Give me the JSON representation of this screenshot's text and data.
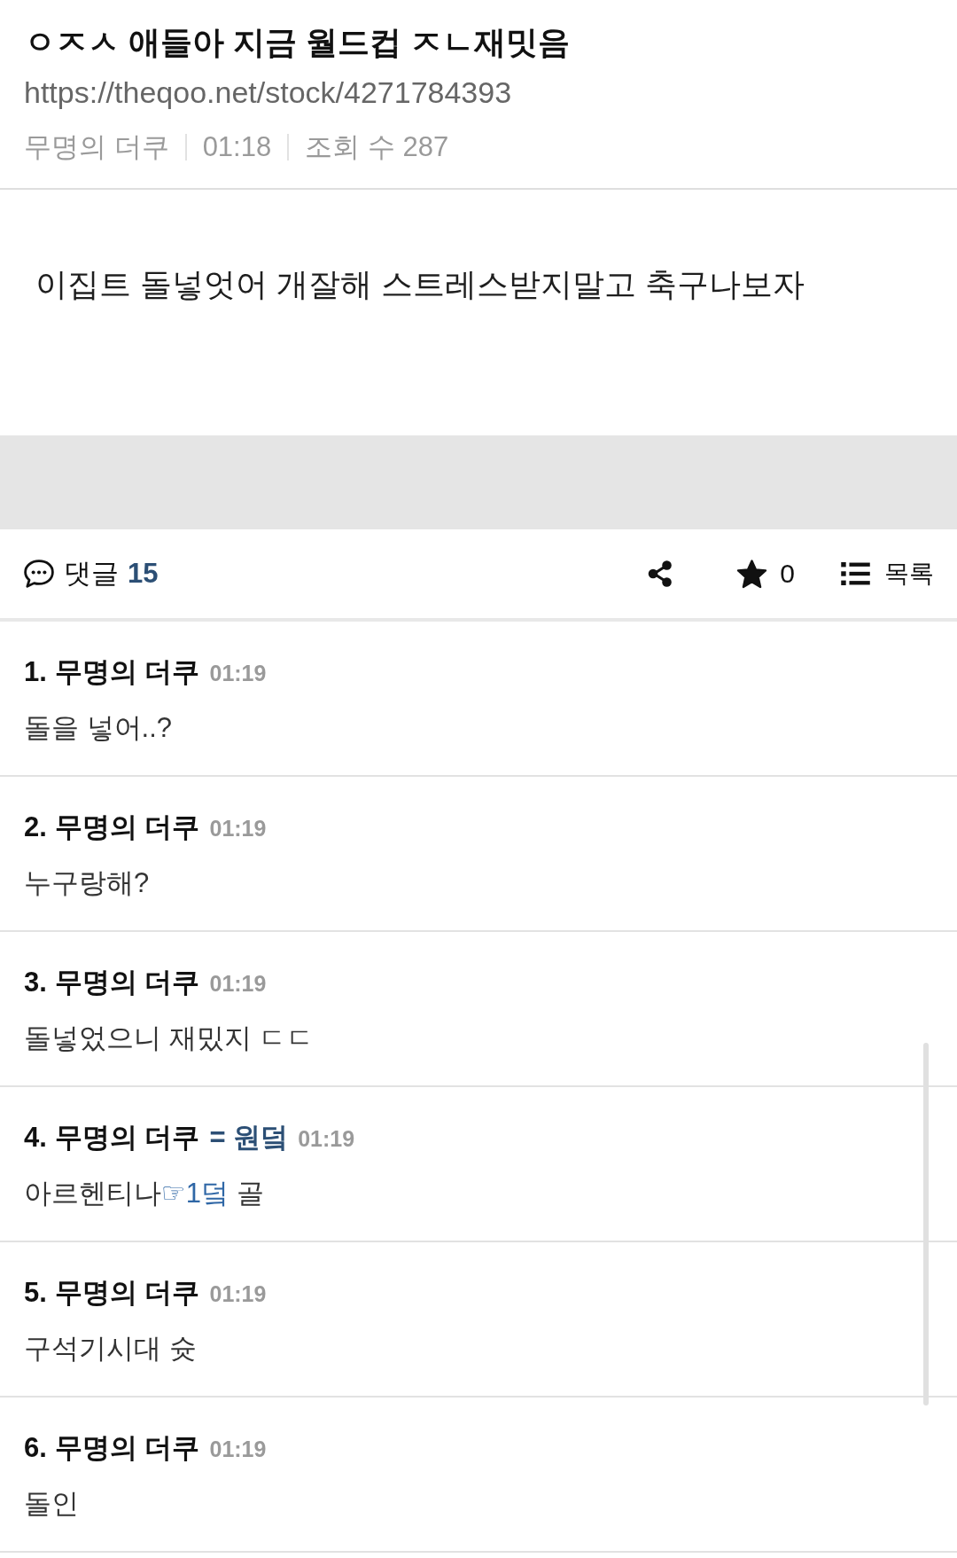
{
  "post": {
    "title": "ㅇㅈㅅ 애들아 지금 월드컵 ㅈㄴ재밋음",
    "url": "https://theqoo.net/stock/4271784393",
    "author": "무명의 더쿠",
    "time": "01:18",
    "views": "조회 수 287",
    "body": "이집트 돌넣엇어 개잘해 스트레스받지말고 축구나보자"
  },
  "action_bar": {
    "comments_label": "댓글",
    "comments_count": "15",
    "star_count": "0",
    "list_label": "목록"
  },
  "comments": [
    {
      "number": "1.",
      "author": "무명의 더쿠",
      "time": "01:19",
      "segments": [
        {
          "kind": "text",
          "text": "돌을 넣어..?"
        }
      ]
    },
    {
      "number": "2.",
      "author": "무명의 더쿠",
      "time": "01:19",
      "segments": [
        {
          "kind": "text",
          "text": "누구랑해?"
        }
      ]
    },
    {
      "number": "3.",
      "author": "무명의 더쿠",
      "time": "01:19",
      "segments": [
        {
          "kind": "text",
          "text": "돌넣었으니 재밌지 ㄷㄷ"
        }
      ]
    },
    {
      "number": "4.",
      "author": "무명의 더쿠",
      "tag": "= 원덬",
      "time": "01:19",
      "segments": [
        {
          "kind": "text",
          "text": "아르헨티나"
        },
        {
          "kind": "link",
          "text": "☞1덬"
        },
        {
          "kind": "text",
          "text": " 골"
        }
      ]
    },
    {
      "number": "5.",
      "author": "무명의 더쿠",
      "time": "01:19",
      "segments": [
        {
          "kind": "text",
          "text": "구석기시대 슛"
        }
      ]
    },
    {
      "number": "6.",
      "author": "무명의 더쿠",
      "time": "01:19",
      "segments": [
        {
          "kind": "text",
          "text": "돌인"
        }
      ]
    }
  ]
}
